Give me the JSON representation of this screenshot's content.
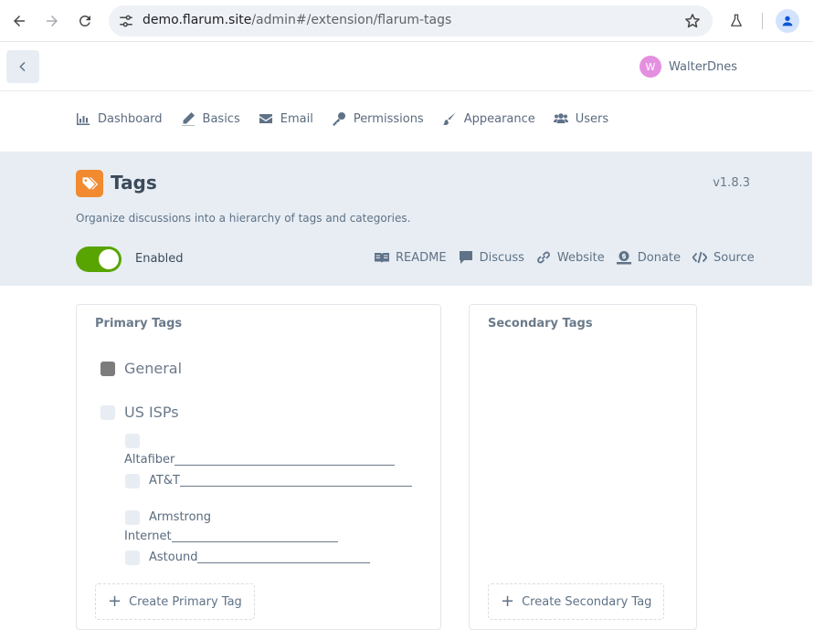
{
  "browser": {
    "url_host": "demo.flarum.site",
    "url_path": "/admin#/extension/flarum-tags"
  },
  "header": {
    "user_initial": "W",
    "username": "WalterDnes",
    "avatar_color": "#e58fe0"
  },
  "nav": {
    "items": [
      {
        "label": "Dashboard",
        "icon": "chart-icon"
      },
      {
        "label": "Basics",
        "icon": "pencil-icon"
      },
      {
        "label": "Email",
        "icon": "envelope-icon"
      },
      {
        "label": "Permissions",
        "icon": "key-icon"
      },
      {
        "label": "Appearance",
        "icon": "paintbrush-icon"
      },
      {
        "label": "Users",
        "icon": "users-icon"
      }
    ]
  },
  "extension": {
    "title": "Tags",
    "version": "v1.8.3",
    "description": "Organize discussions into a hierarchy of tags and categories.",
    "enabled_label": "Enabled",
    "enabled": true,
    "icon_color": "#f28a30",
    "toggle_color": "#58a400",
    "links": [
      {
        "label": "README",
        "icon": "book-icon"
      },
      {
        "label": "Discuss",
        "icon": "comment-icon"
      },
      {
        "label": "Website",
        "icon": "link-icon"
      },
      {
        "label": "Donate",
        "icon": "donate-icon"
      },
      {
        "label": "Source",
        "icon": "code-icon"
      }
    ]
  },
  "primary": {
    "title": "Primary Tags",
    "tags": [
      {
        "name": "General",
        "color": "#7c7c7c"
      },
      {
        "name": "US ISPs",
        "color": "#e7edf3"
      }
    ],
    "children": [
      {
        "name": "Altafiber"
      },
      {
        "name": "AT&T"
      },
      {
        "name": "Armstrong"
      },
      {
        "name": "Internet"
      },
      {
        "name": "Astound"
      }
    ],
    "create_label": "Create Primary Tag"
  },
  "secondary": {
    "title": "Secondary Tags",
    "create_label": "Create Secondary Tag"
  }
}
